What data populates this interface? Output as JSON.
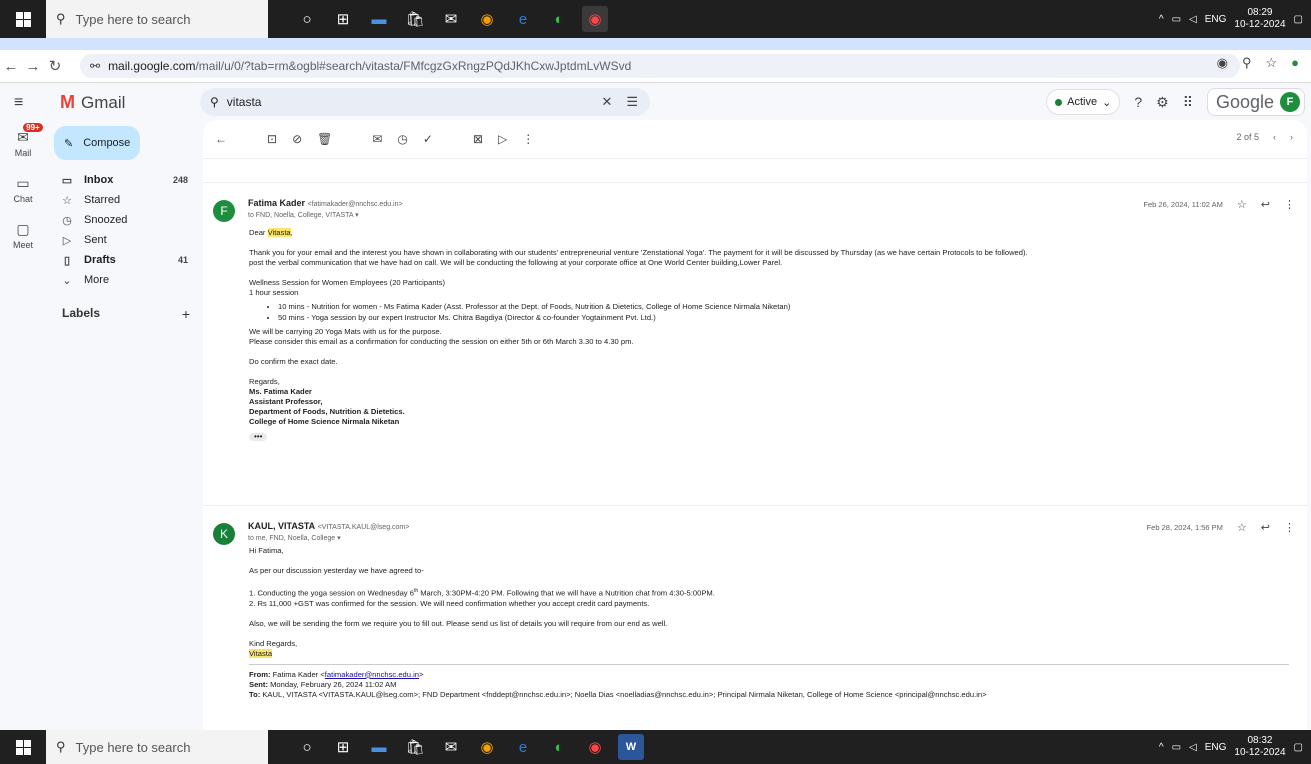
{
  "taskbar": {
    "search_placeholder": "Type here to search",
    "lang": "ENG",
    "time_top": "08:29",
    "date_top": "10-12-2024",
    "time_bottom": "08:32",
    "date_bottom": "10-12-2024"
  },
  "browser": {
    "url_domain": "mail.google.com",
    "url_path": "/mail/u/0/?tab=rm&ogbl#search/vitasta/FMfcgzGxRngzPQdJKhCxwJptdmLvWSvd"
  },
  "gmail": {
    "brand": "Gmail",
    "search_value": "vitasta",
    "status": "Active",
    "google": "Google",
    "avatar_letter": "F"
  },
  "rail": {
    "mail": "Mail",
    "chat": "Chat",
    "meet": "Meet",
    "badge": "99+"
  },
  "sidebar": {
    "compose": "Compose",
    "items": [
      {
        "label": "Inbox",
        "count": "248"
      },
      {
        "label": "Starred",
        "count": ""
      },
      {
        "label": "Snoozed",
        "count": ""
      },
      {
        "label": "Sent",
        "count": ""
      },
      {
        "label": "Drafts",
        "count": "41"
      },
      {
        "label": "More",
        "count": ""
      }
    ],
    "labels": "Labels",
    "labels_add": "+"
  },
  "thread": {
    "pager": "2 of 5",
    "msg1": {
      "avatar": "F",
      "from_name": "Fatima Kader",
      "from_email": "<fatimakader@nnchsc.edu.in>",
      "to": "to FND, Noella, College, VITASTA",
      "date": "Feb 26, 2024, 11:02 AM",
      "greeting_pre": "Dear ",
      "greeting_name": "Vitasta",
      "greeting_post": ",",
      "p1a": "Thank you for your email and the interest you have shown in collaborating with our students' entrepreneurial venture 'Zenstational Yoga'. The payment for it will be discussed by Thursday (as we have certain Protocols to be followed).",
      "p1b": "post the verbal communication that we have had on call. We will be conducting the following at your corporate office at One World Center building,Lower Parel.",
      "p2a": "Wellness Session for Women Employees  (20 Participants)",
      "p2b": "1 hour session",
      "b1": "10 mins - Nutrition for women - Ms Fatima Kader (Asst. Professor at the Dept. of Foods, Nutrition & Dietetics, College of Home Science Nirmala Niketan)",
      "b2": "50 mins - Yoga session by our expert Instructor Ms. Chitra Bagdiya (Director & co-founder Yogtainment Pvt. Ltd.)",
      "p3a": "We will be carrying 20 Yoga Mats with us for the purpose.",
      "p3b": "Please consider this email as a confirmation for conducting the session on either 5th or 6th March 3.30 to 4.30 pm.",
      "p4": "Do confirm the exact date.",
      "s1": "Regards,",
      "s2": "Ms. Fatima Kader",
      "s3": "Assistant Professor,",
      "s4": "Department of Foods, Nutrition & Dietetics.",
      "s5": "College of Home Science Nirmala Niketan"
    },
    "msg2": {
      "avatar": "K",
      "from_name": "KAUL, VITASTA",
      "from_email": "<VITASTA.KAUL@lseg.com>",
      "to": "to me, FND, Noella, College",
      "date": "Feb 28, 2024, 1:56 PM",
      "greeting": "Hi Fatima,",
      "p1": "As per our discussion yesterday we have agreed to-",
      "l1a": "1. Conducting the yoga session on Wednesday 6",
      "l1sup": "th",
      "l1b": " March, 3:30PM-4:20 PM. Following that we will have a Nutrition chat from 4:30-5:00PM.",
      "l2": "2. Rs 11,000 +GST was confirmed for the session. We will need confirmation whether you accept credit card payments.",
      "p2": "Also, we will be sending the form we require you to fill out. Please send us list of details you will require from our end as well.",
      "s1": "Kind Regards,",
      "s2": "Vitasta",
      "q_from_label": "From:",
      "q_from": " Fatima Kader <",
      "q_from_email": "fatimakader@nnchsc.edu.in",
      "q_from_end": ">",
      "q_sent_label": "Sent:",
      "q_sent": " Monday, February 26, 2024 11:02 AM",
      "q_to_label": "To:",
      "q_to": " KAUL, VITASTA <VITASTA.KAUL@lseg.com>; FND Department <fnddept@nnchsc.edu.in>; Noella Dias <noelladias@nnchsc.edu.in>; Principal Nirmala Niketan, College of Home Science <principal@nnchsc.edu.in>"
    }
  },
  "colors": {
    "compose_bg": "#c2e7ff",
    "avatar_f": "#1e8e3e",
    "avatar_k": "#188038",
    "highlight": "#fbe46a",
    "badge": "#d93025"
  }
}
